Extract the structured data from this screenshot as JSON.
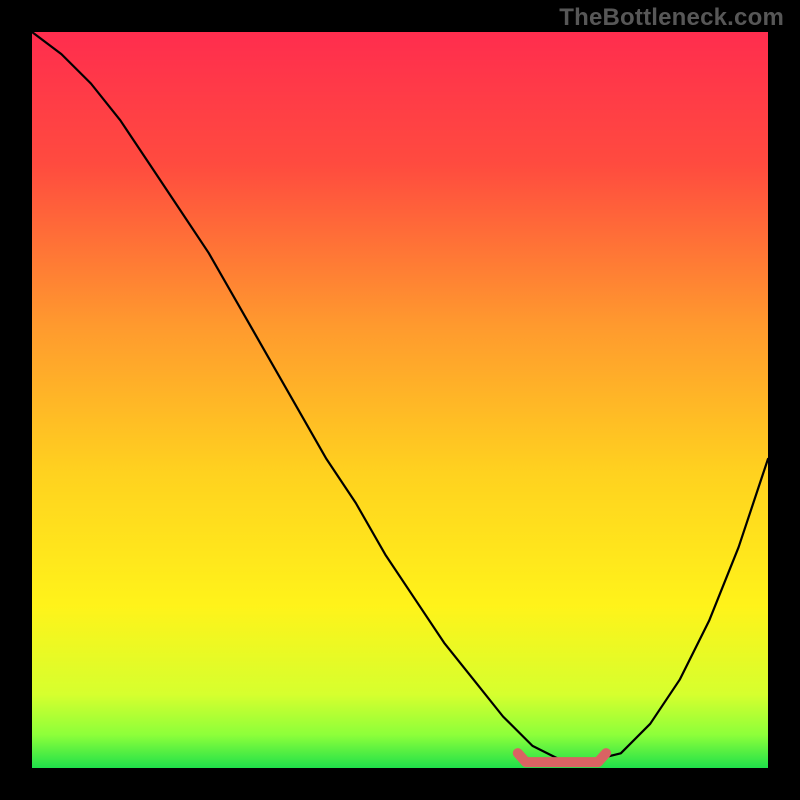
{
  "watermark": "TheBottleneck.com",
  "chart_data": {
    "type": "line",
    "title": "",
    "xlabel": "",
    "ylabel": "",
    "xlim": [
      0,
      100
    ],
    "ylim": [
      0,
      100
    ],
    "grid": false,
    "legend": false,
    "background_gradient_top": "#ff2d4e",
    "background_gradient_bottom": "#1fe04a",
    "curve_color": "#000000",
    "optimal_marker_color": "#d96363",
    "series": [
      {
        "name": "bottleneck-curve",
        "x": [
          0,
          4,
          8,
          12,
          16,
          20,
          24,
          28,
          32,
          36,
          40,
          44,
          48,
          52,
          56,
          60,
          64,
          68,
          72,
          76,
          80,
          84,
          88,
          92,
          96,
          100
        ],
        "y": [
          100,
          97,
          93,
          88,
          82,
          76,
          70,
          63,
          56,
          49,
          42,
          36,
          29,
          23,
          17,
          12,
          7,
          3,
          1,
          1,
          2,
          6,
          12,
          20,
          30,
          42
        ]
      }
    ],
    "optimal_range": {
      "x_start": 66,
      "x_end": 78,
      "y": 0.8
    },
    "annotations": []
  }
}
